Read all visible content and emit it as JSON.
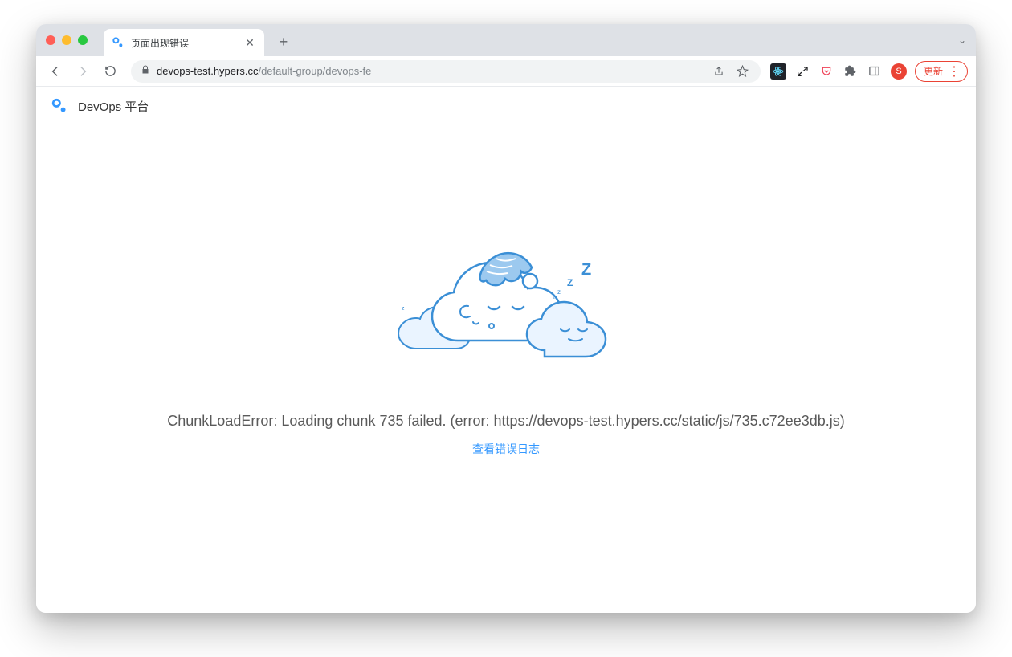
{
  "browser": {
    "tab_title": "页面出现错误",
    "url_host": "devops-test.hypers.cc",
    "url_path": "/default-group/devops-fe",
    "update_label": "更新",
    "avatar_initial": "S"
  },
  "page": {
    "brand_title": "DevOps 平台",
    "error_message": "ChunkLoadError: Loading chunk 735 failed. (error: https://devops-test.hypers.cc/static/js/735.c72ee3db.js)",
    "error_log_link": "查看错误日志"
  }
}
